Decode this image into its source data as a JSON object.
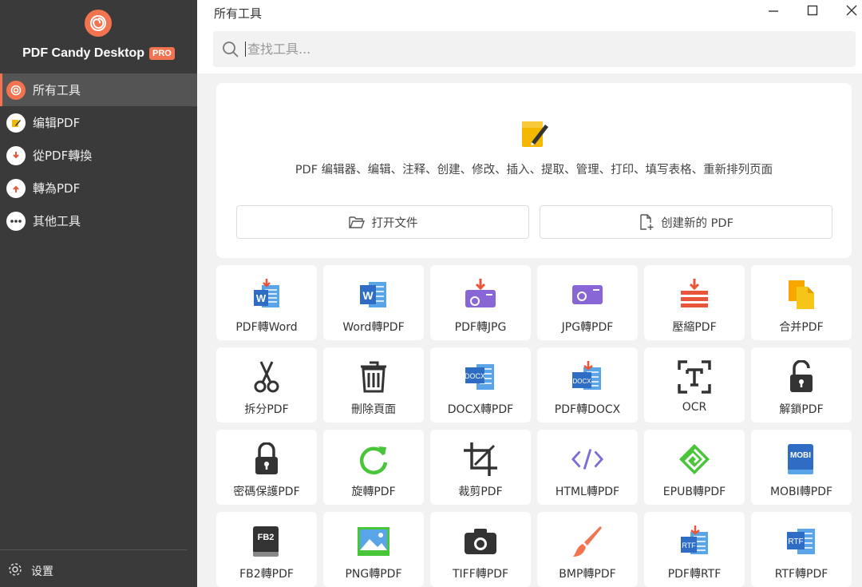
{
  "app": {
    "brand": "PDF Candy Desktop",
    "badge": "PRO",
    "accent": "#f2734f"
  },
  "sidebar": {
    "items": [
      {
        "label": "所有工具",
        "icon": "spiral-logo-icon",
        "active": true
      },
      {
        "label": "编辑PDF",
        "icon": "edit-pdf-icon"
      },
      {
        "label": "從PDF轉換",
        "icon": "download-arrow-icon"
      },
      {
        "label": "轉為PDF",
        "icon": "upload-arrow-icon"
      },
      {
        "label": "其他工具",
        "icon": "more-dots-icon"
      }
    ],
    "settings_label": "设置"
  },
  "header": {
    "title": "所有工具",
    "search_placeholder": "查找工具..."
  },
  "hero": {
    "description": "PDF 编辑器、编辑、注释、创建、修改、插入、提取、管理、打印、填写表格、重新排列页面",
    "open_file": "打开文件",
    "create_new": "创建新的 PDF"
  },
  "tools": [
    {
      "label": "PDF轉Word",
      "icon": "pdf-to-word-icon"
    },
    {
      "label": "Word轉PDF",
      "icon": "word-to-pdf-icon"
    },
    {
      "label": "PDF轉JPG",
      "icon": "pdf-to-jpg-icon"
    },
    {
      "label": "JPG轉PDF",
      "icon": "jpg-to-pdf-icon"
    },
    {
      "label": "壓縮PDF",
      "icon": "compress-pdf-icon"
    },
    {
      "label": "合并PDF",
      "icon": "merge-pdf-icon"
    },
    {
      "label": "拆分PDF",
      "icon": "scissors-icon"
    },
    {
      "label": "刪除頁面",
      "icon": "trash-icon"
    },
    {
      "label": "DOCX轉PDF",
      "icon": "docx-to-pdf-icon"
    },
    {
      "label": "PDF轉DOCX",
      "icon": "pdf-to-docx-icon"
    },
    {
      "label": "OCR",
      "icon": "ocr-icon"
    },
    {
      "label": "解鎖PDF",
      "icon": "unlock-icon"
    },
    {
      "label": "密碼保護PDF",
      "icon": "lock-icon"
    },
    {
      "label": "旋轉PDF",
      "icon": "rotate-icon"
    },
    {
      "label": "裁剪PDF",
      "icon": "crop-icon"
    },
    {
      "label": "HTML轉PDF",
      "icon": "html-code-icon"
    },
    {
      "label": "EPUB轉PDF",
      "icon": "epub-icon"
    },
    {
      "label": "MOBI轉PDF",
      "icon": "mobi-book-icon"
    },
    {
      "label": "FB2轉PDF",
      "icon": "fb2-book-icon"
    },
    {
      "label": "PNG轉PDF",
      "icon": "png-image-icon"
    },
    {
      "label": "TIFF轉PDF",
      "icon": "camera-icon"
    },
    {
      "label": "BMP轉PDF",
      "icon": "paintbrush-icon"
    },
    {
      "label": "PDF轉RTF",
      "icon": "pdf-to-rtf-icon"
    },
    {
      "label": "RTF轉PDF",
      "icon": "rtf-to-pdf-icon"
    }
  ]
}
